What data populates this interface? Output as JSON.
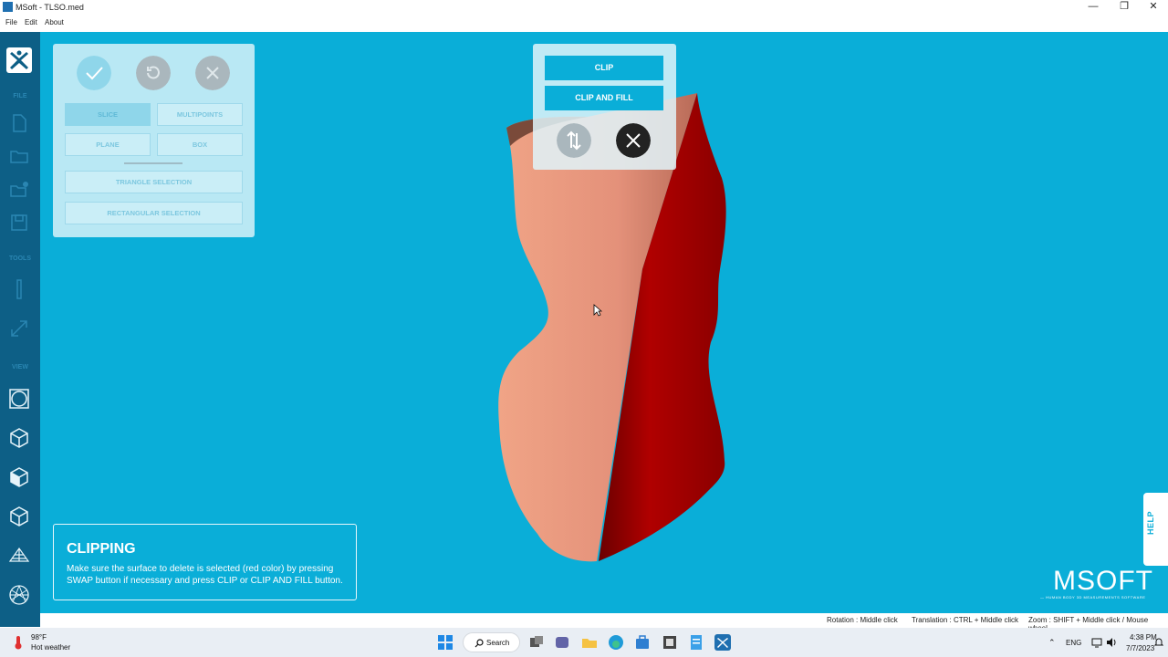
{
  "window": {
    "title": "MSoft - TLSO.med",
    "minimize": "—",
    "maximize": "❐",
    "close": "✕"
  },
  "menu": [
    "File",
    "Edit",
    "About"
  ],
  "sidebar": {
    "sections": {
      "file": "FILE",
      "tools": "TOOLS",
      "view": "VIEW"
    },
    "icons": [
      "new-file-icon",
      "open-folder-icon",
      "import-icon",
      "save-icon",
      "ruler-icon",
      "resize-icon",
      "view-perspective-icon",
      "view-cube-front-icon",
      "view-cube-side-icon",
      "view-cube-top-icon",
      "wireframe-icon",
      "sphere-icon"
    ]
  },
  "selection_panel": {
    "buttons": {
      "slice": "SLICE",
      "multipoints": "MULTIPOINTS",
      "plane": "PLANE",
      "box": "BOX",
      "triangle": "TRIANGLE SELECTION",
      "rectangular": "RECTANGULAR SELECTION"
    },
    "active": "slice"
  },
  "clip_panel": {
    "clip": "CLIP",
    "clip_and_fill": "CLIP AND FILL"
  },
  "info": {
    "heading": "CLIPPING",
    "text": "Make sure the surface to delete is selected (red color) by pressing SWAP button if necessary and press CLIP or CLIP AND FILL button."
  },
  "help": "HELP",
  "brand": {
    "name": "MSOFT",
    "tagline": "— HUMAN BODY 3D MEASUREMENTS SOFTWARE"
  },
  "status": {
    "rotation": "Rotation : Middle click",
    "translation": "Translation : CTRL + Middle click",
    "zoom": "Zoom : SHIFT + Middle click / Mouse wheel"
  },
  "taskbar": {
    "weather_temp": "98°F",
    "weather_desc": "Hot weather",
    "search": "Search",
    "lang": "ENG",
    "time": "4:38 PM",
    "date": "7/7/2023"
  },
  "colors": {
    "viewport": "#0aaed8",
    "sidebar": "#0d5f86",
    "skin": "#e6967a",
    "selected_red": "#b00000"
  }
}
